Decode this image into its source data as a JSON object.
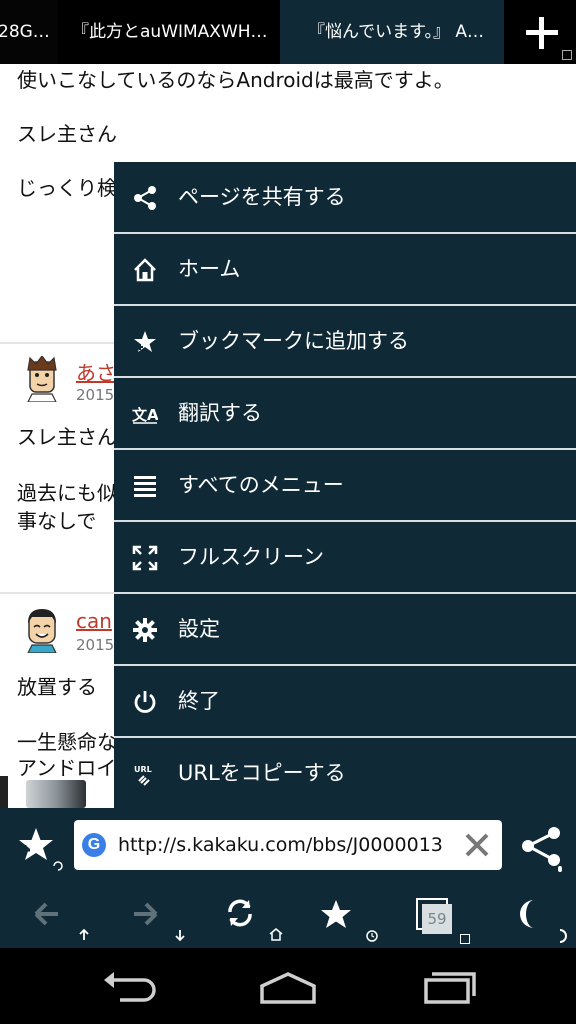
{
  "tabs": [
    {
      "label": "28G…"
    },
    {
      "label": "『此方とauWIMAXWH…"
    },
    {
      "label": "『悩んでいます。』 A…"
    }
  ],
  "page": {
    "line1": "使いこなしているのならAndroidは最高ですよ。",
    "line2": "スレ主さん",
    "line3": "じっくり検",
    "post1": {
      "user": "あさ",
      "date": "2015",
      "line1": "スレ主さん",
      "line2": "過去にも似",
      "line3": "事なしで"
    },
    "post2": {
      "user": "can",
      "date": "2015",
      "line1": "放置する",
      "line2": "一生懸命な",
      "line3": "アンドロイ"
    }
  },
  "menu": {
    "items": [
      {
        "label": "ページを共有する",
        "icon": "share-icon"
      },
      {
        "label": "ホーム",
        "icon": "home-icon"
      },
      {
        "label": "ブックマークに追加する",
        "icon": "bookmark-add-icon"
      },
      {
        "label": "翻訳する",
        "icon": "translate-icon"
      },
      {
        "label": "すべてのメニュー",
        "icon": "menu-list-icon"
      },
      {
        "label": "フルスクリーン",
        "icon": "fullscreen-icon"
      },
      {
        "label": "設定",
        "icon": "settings-icon"
      },
      {
        "label": "終了",
        "icon": "power-icon"
      },
      {
        "label": "URLをコピーする",
        "icon": "copy-url-icon"
      }
    ]
  },
  "toolbar": {
    "url": "http://s.kakaku.com/bbs/J0000013",
    "tab_count": "59",
    "g_label": "G"
  },
  "colors": {
    "menu_bg": "#0f2a36",
    "toolbar_bg": "#0f2a36",
    "username": "#c0392b"
  }
}
